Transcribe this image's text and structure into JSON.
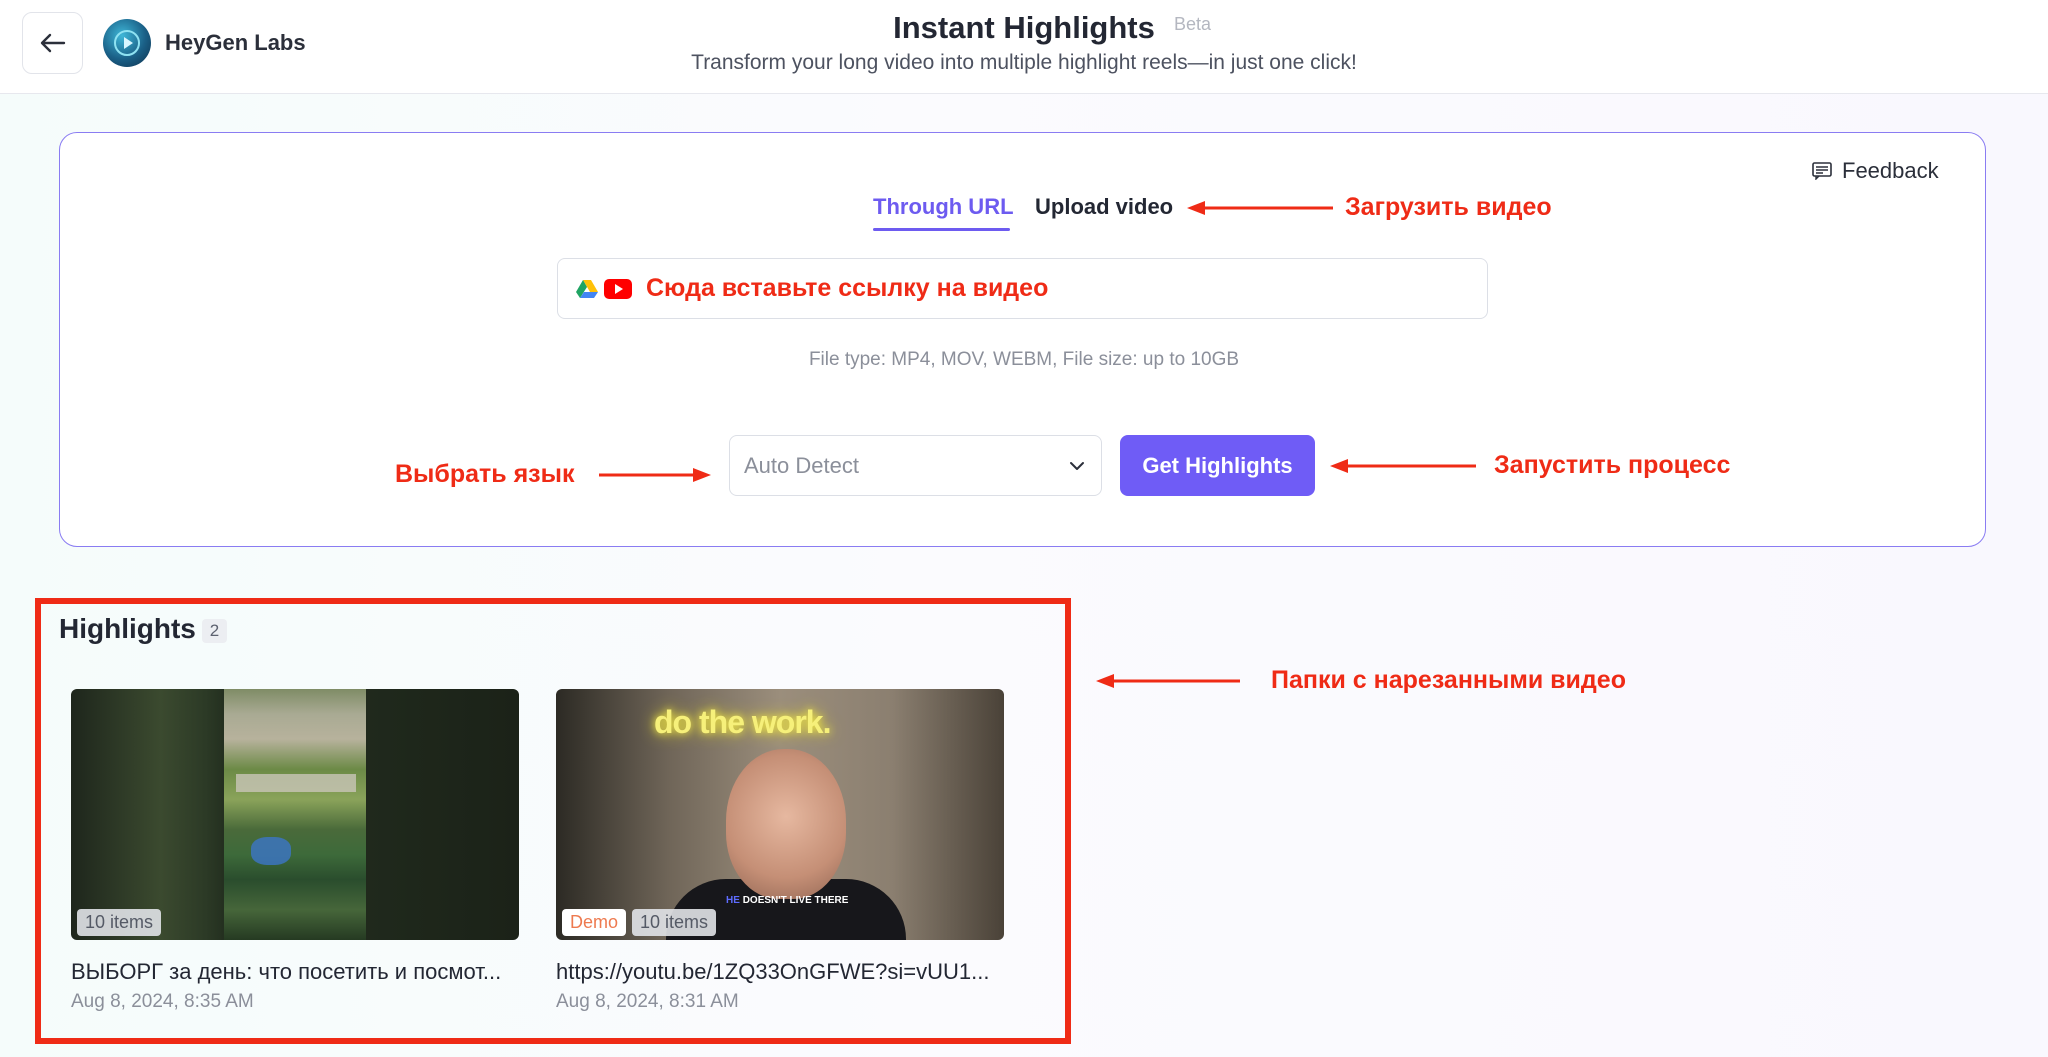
{
  "header": {
    "brand_name": "HeyGen Labs",
    "title": "Instant Highlights",
    "beta": "Beta",
    "subtitle": "Transform your long video into multiple highlight reels—in just one click!"
  },
  "feedback_label": "Feedback",
  "tabs": [
    {
      "label": "Through URL",
      "active": true
    },
    {
      "label": "Upload video",
      "active": false
    }
  ],
  "url_input": {
    "text": "Сюда вставьте ссылку на видео",
    "icons": [
      "google-drive-icon",
      "youtube-icon"
    ]
  },
  "file_hint": "File type: MP4, MOV, WEBM, File size: up to 10GB",
  "language_select": {
    "selected": "Auto Detect"
  },
  "get_button": "Get Highlights",
  "annotations": {
    "upload": "Загрузить видео",
    "language": "Выбрать язык",
    "start": "Запустить процесс",
    "folders": "Папки с нарезанными видео"
  },
  "highlights": {
    "title": "Highlights",
    "count": "2",
    "items": [
      {
        "title": "ВЫБОРГ за день: что посетить и посмот...",
        "date": "Aug 8, 2024, 8:35 AM",
        "items_badge": "10 items",
        "demo_badge": null
      },
      {
        "title": "https://youtu.be/1ZQ33OnGFWE?si=vUU1...",
        "date": "Aug 8, 2024, 8:31 AM",
        "items_badge": "10 items",
        "demo_badge": "Demo",
        "thumb_neon": "do the work.",
        "thumb_caption_accent": "HE",
        "thumb_caption": "DOESN'T LIVE THERE"
      }
    ]
  },
  "colors": {
    "accent": "#6f5cf6",
    "annotation": "#ef2b16",
    "demo_badge": "#ee7a4f"
  }
}
